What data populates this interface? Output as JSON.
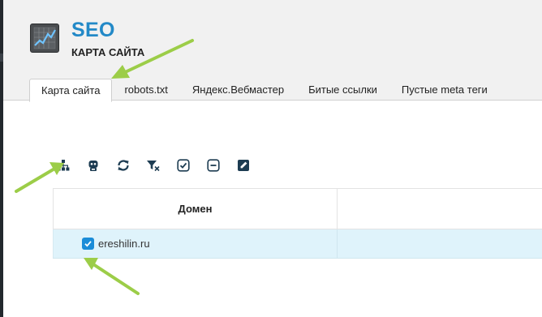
{
  "app": {
    "title": "SEO",
    "subtitle": "КАРТА САЙТА",
    "icon": "line-chart-icon"
  },
  "tabs": [
    {
      "label": "Карта сайта",
      "active": true
    },
    {
      "label": "robots.txt",
      "active": false
    },
    {
      "label": "Яндекс.Вебмастер",
      "active": false
    },
    {
      "label": "Битые ссылки",
      "active": false
    },
    {
      "label": "Пустые meta теги",
      "active": false
    }
  ],
  "toolbar": [
    {
      "icon": "sitemap-icon"
    },
    {
      "icon": "robot-icon"
    },
    {
      "icon": "refresh-icon"
    },
    {
      "icon": "clear-filter-icon"
    },
    {
      "icon": "check-all-icon"
    },
    {
      "icon": "uncheck-all-icon"
    },
    {
      "icon": "edit-icon"
    }
  ],
  "grid": {
    "columns": [
      "Домен",
      ""
    ],
    "rows": [
      {
        "domain": "ereshilin.ru",
        "checked": true,
        "selected": true
      }
    ]
  },
  "colors": {
    "accent": "#2389c7",
    "checkbox": "#1a8cd8",
    "row_selected": "#dff3fb",
    "annotation_arrow": "#9ccd48",
    "header_bg": "#f1f1f1"
  }
}
